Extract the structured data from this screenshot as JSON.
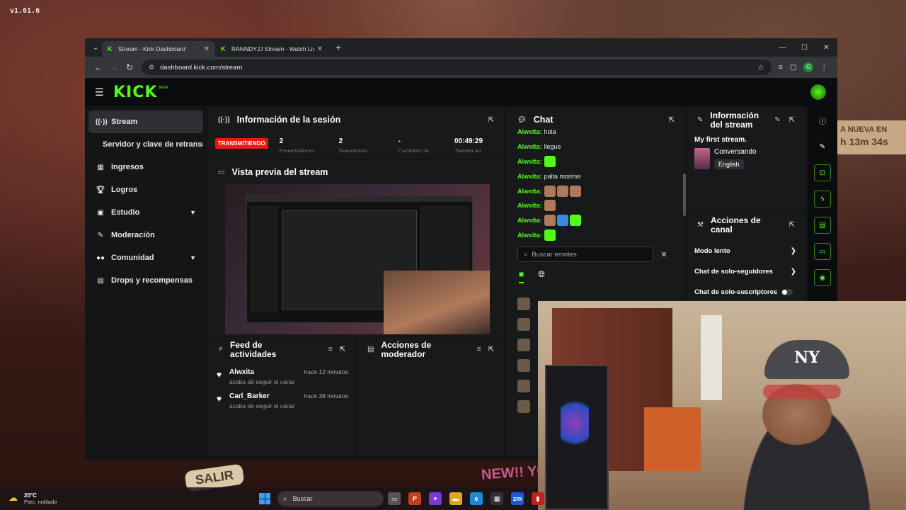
{
  "desktop": {
    "version": "v1.61.6",
    "banner_line1": "A NUEVA EN",
    "banner_line2": "h 13m 34s",
    "salir": "SALIR",
    "newyou": "NEW!! YOUTO"
  },
  "browser": {
    "tabs": [
      {
        "title": "Stream - Kick Dashboard",
        "active": true
      },
      {
        "title": "RANNDYJJ Stream - Watch Live",
        "active": false
      }
    ],
    "url": "dashboard.kick.com/stream",
    "profile_initial": "G"
  },
  "kick": {
    "logo": "KICK",
    "beta": "BETA",
    "accent": "#53fc18"
  },
  "sidebar": {
    "items": [
      {
        "label": "Stream",
        "icon": "broadcast-icon"
      },
      {
        "label": "Servidor y clave de retransmisión"
      },
      {
        "label": "Ingresos",
        "icon": "chart-icon"
      },
      {
        "label": "Logros",
        "icon": "trophy-icon"
      },
      {
        "label": "Estudio",
        "icon": "grid-icon"
      },
      {
        "label": "Moderación",
        "icon": "wrench-icon"
      },
      {
        "label": "Comunidad",
        "icon": "people-icon"
      },
      {
        "label": "Drops y recompensas",
        "icon": "gift-icon"
      }
    ]
  },
  "session": {
    "title": "Información de la sesión",
    "status": "TRANSMITIENDO",
    "stats": [
      {
        "value": "2",
        "label": "Espectadores"
      },
      {
        "value": "2",
        "label": "Seguidores"
      },
      {
        "value": "-",
        "label": "Cantidad de"
      },
      {
        "value": "00:49:29",
        "label": "Tiempo en"
      }
    ]
  },
  "preview": {
    "title": "Vista previa del stream"
  },
  "feed": {
    "title_line1": "Feed de",
    "title_line2": "actividades",
    "items": [
      {
        "name": "Alwxita",
        "desc": "acaba de seguir el canal",
        "time": "hace 12 minutos"
      },
      {
        "name": "Carl_Barker",
        "desc": "acaba de seguir el canal",
        "time": "hace 38 minutos"
      }
    ]
  },
  "mod_actions": {
    "title_line1": "Acciones de",
    "title_line2": "moderador"
  },
  "chat": {
    "title": "Chat",
    "messages": [
      {
        "user": "Alwxita",
        "text": "hola"
      },
      {
        "user": "Alwxita",
        "text": "llegue"
      },
      {
        "user": "Alwxita",
        "text": ""
      },
      {
        "user": "Alwxita",
        "text": "palta morirse"
      },
      {
        "user": "Alwxita",
        "text": ""
      },
      {
        "user": "Alwxita",
        "text": ""
      },
      {
        "user": "Alwxita",
        "text": ""
      },
      {
        "user": "Alwxita",
        "text": ""
      }
    ],
    "emote_search_placeholder": "Buscar emotes"
  },
  "stream_info": {
    "title_line1": "Información",
    "title_line2": "del stream",
    "stream_title": "My first stream.",
    "category": "Conversando",
    "language": "English"
  },
  "channel_actions": {
    "title_line1": "Acciones de",
    "title_line2": "canal",
    "rows": [
      {
        "label": "Modo lento"
      },
      {
        "label": "Chat de solo-seguidores"
      },
      {
        "label": "Chat de solo-suscriptores"
      }
    ]
  },
  "webcam": {
    "cap_logo": "NY"
  },
  "taskbar": {
    "temp": "20°C",
    "weather": "Parc. nublado",
    "search": "Buscar"
  }
}
